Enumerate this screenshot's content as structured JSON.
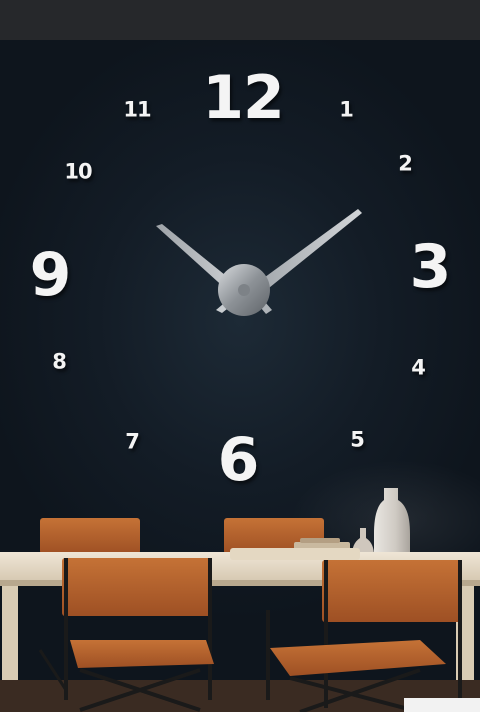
{
  "clock": {
    "numerals": {
      "n12": "12",
      "n1": "1",
      "n2": "2",
      "n3": "3",
      "n4": "4",
      "n5": "5",
      "n6": "6",
      "n7": "7",
      "n8": "8",
      "n9": "9",
      "n10": "10",
      "n11": "11"
    }
  },
  "colors": {
    "wall": "#131c26",
    "numerals": "#f4f4f4",
    "hands": "#b9bec3",
    "chair_leather": "#b9652c",
    "table_top": "#e7dcc8"
  }
}
